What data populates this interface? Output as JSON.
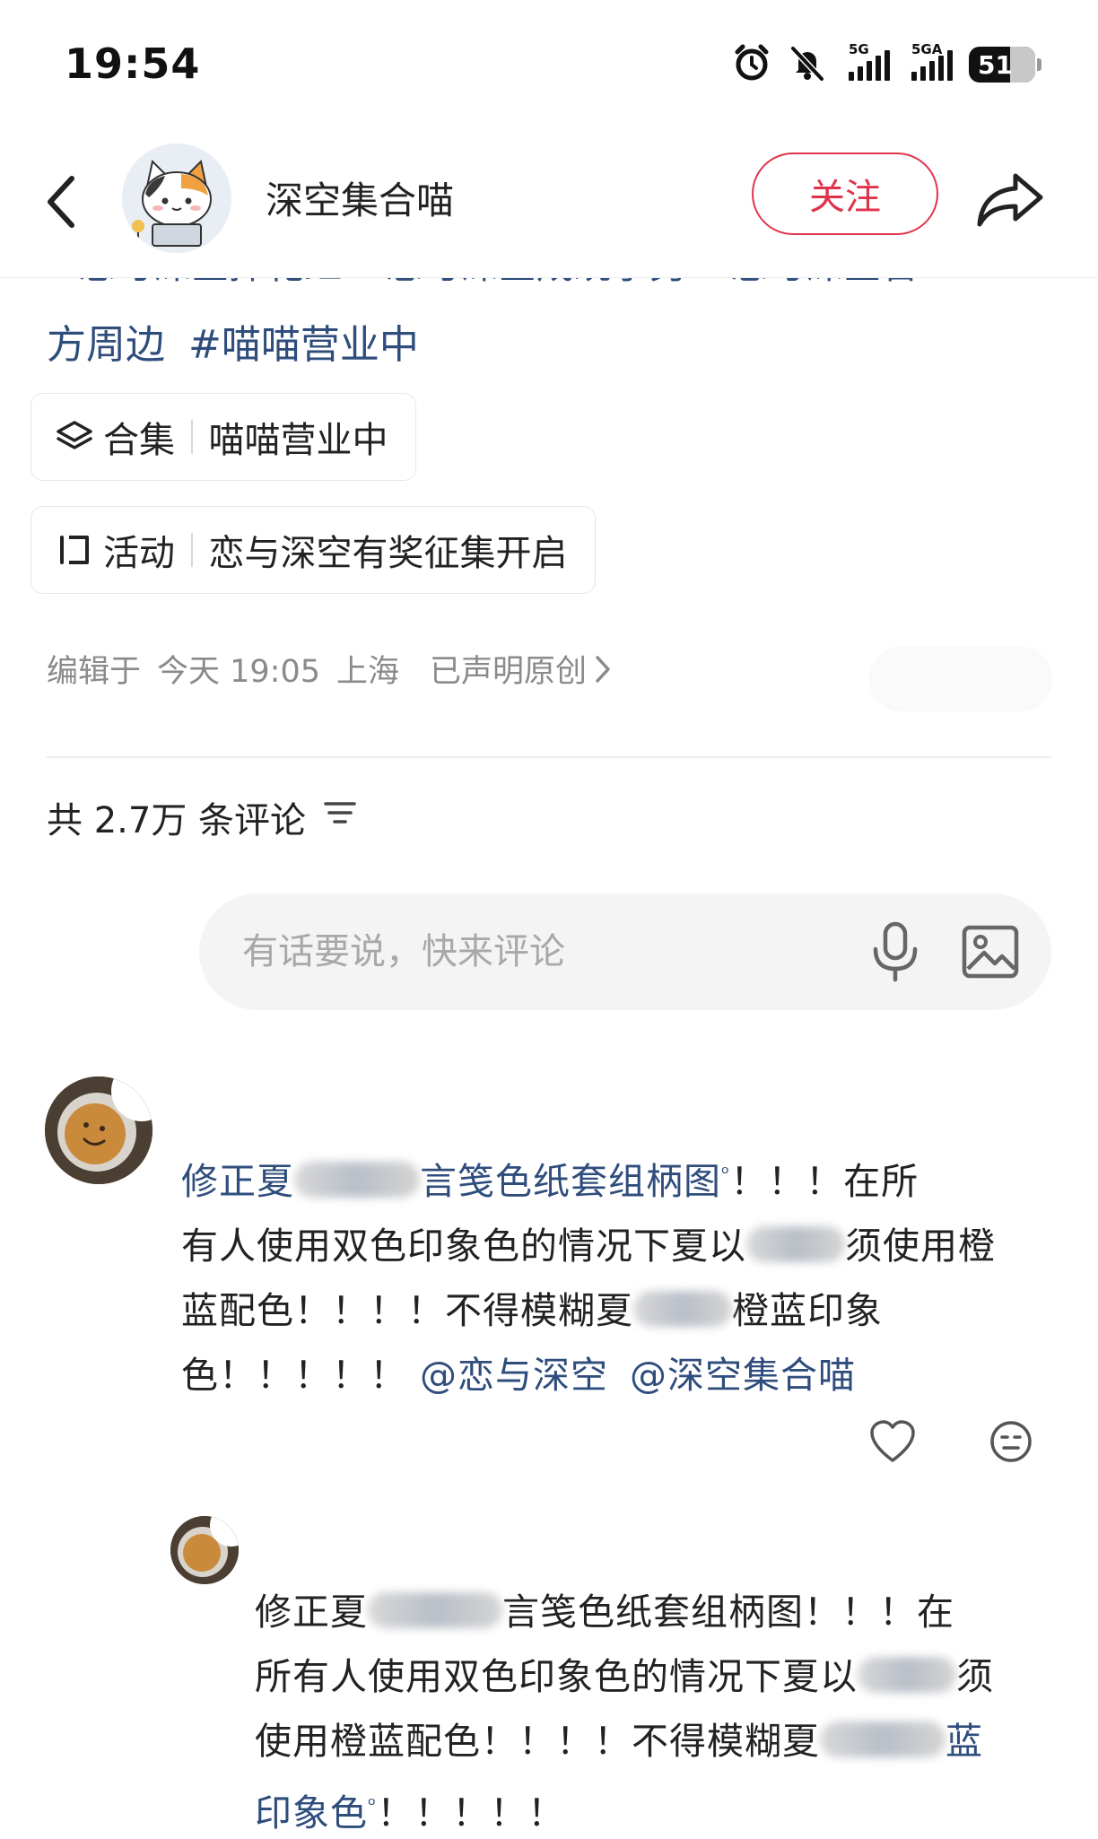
{
  "status_bar": {
    "time": "19:54",
    "network1": "5G",
    "network2": "5GA",
    "battery": "51"
  },
  "header": {
    "author": "深空集合喵",
    "follow_label": "关注"
  },
  "tags": {
    "line1_cut": "#恋与深空摔花红 #恋与深空成统学另 #恋与深空官",
    "line2": [
      "方周边",
      "#喵喵营业中"
    ]
  },
  "chips": [
    {
      "type": "合集",
      "value": "喵喵营业中"
    },
    {
      "type": "活动",
      "value": "恋与深空有奖征集开启"
    }
  ],
  "meta": {
    "edited_prefix": "编辑于",
    "date": "今天 19:05",
    "location": "上海",
    "original": "已声明原创"
  },
  "comments_header": {
    "count_text": "共 2.7万 条评论"
  },
  "comment_input": {
    "placeholder": "有话要说，快来评论"
  },
  "comments": [
    {
      "l1a": "修正夏",
      "l1b": "言笺色纸套组柄图",
      "l1c": "！！！在所",
      "l2a": "有人使用双色印象色的情况下夏以",
      "l2b": "须使用橙",
      "l3a": "蓝配色！！！！不得模糊夏",
      "l3b": "橙蓝印象",
      "l4a": "色！！！！！",
      "mention1": "@恋与深空",
      "mention2": "@深空集合喵"
    },
    {
      "l1a": "修正夏",
      "l1b": "言笺色纸套组柄图！！！在",
      "l2a": "所有人使用双色印象色的情况下夏以",
      "l2b": "须",
      "l3a": "使用橙蓝配色！！！！不得模糊夏",
      "l3b": "蓝",
      "l4a": "印象色",
      "l4b": "！！！！！"
    }
  ],
  "colors": {
    "accent": "#e0334b",
    "link": "#2f4d7c",
    "muted": "#8a8a8a"
  }
}
